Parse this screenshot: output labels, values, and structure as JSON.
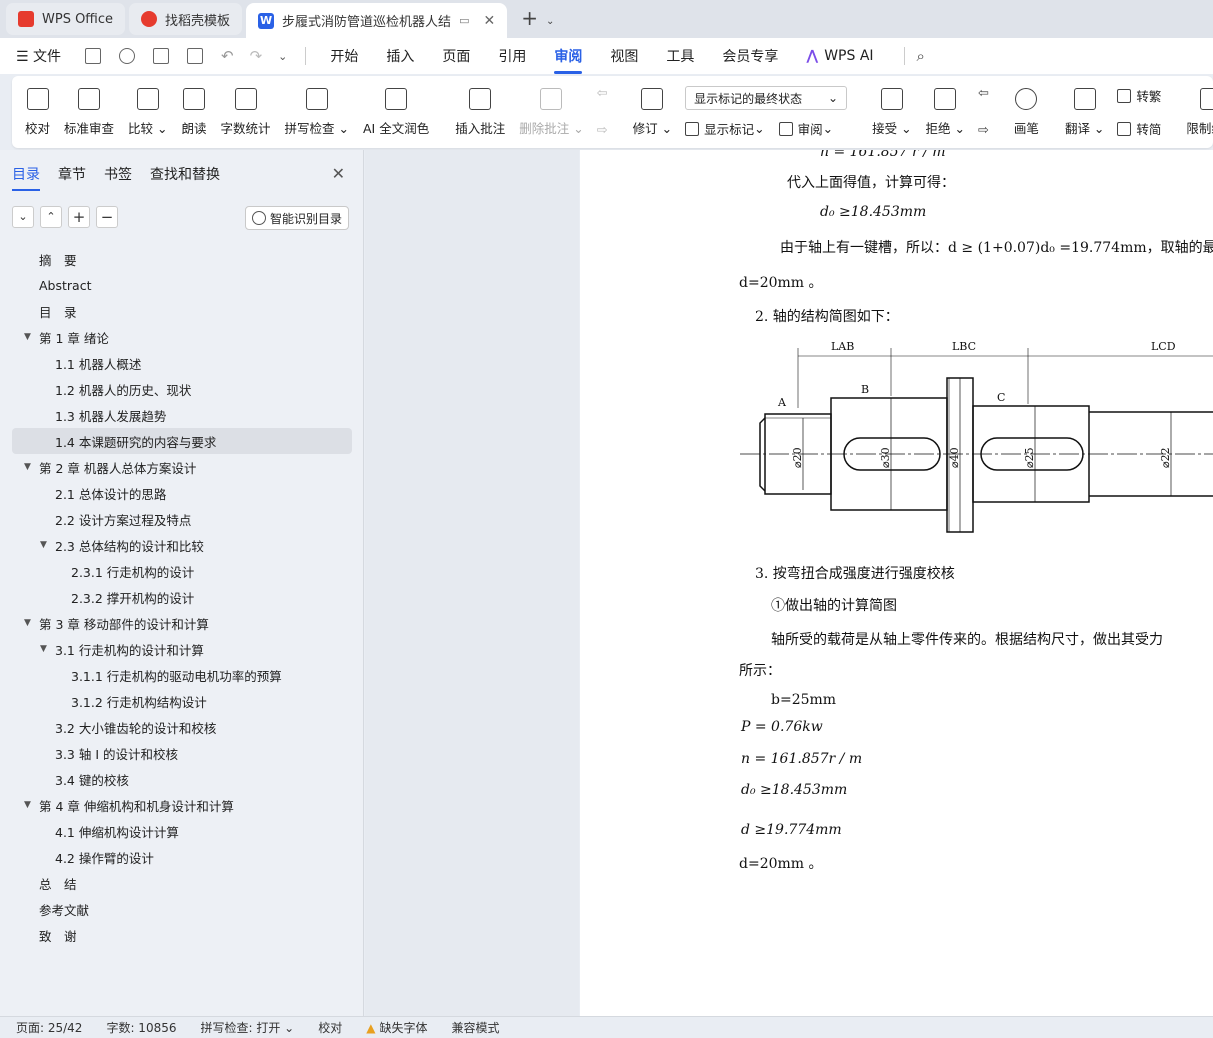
{
  "tabs": [
    {
      "label": "WPS Office"
    },
    {
      "label": "找稻壳模板"
    },
    {
      "label": "步履式消防管道巡检机器人结"
    }
  ],
  "menu": {
    "file": "文件",
    "items": [
      "开始",
      "插入",
      "页面",
      "引用",
      "审阅",
      "视图",
      "工具",
      "会员专享"
    ],
    "active": "审阅",
    "ai": "WPS AI"
  },
  "ribbon": {
    "proofread": "校对",
    "standard_review": "标准审查",
    "compare": "比较",
    "read_aloud": "朗读",
    "word_count": "字数统计",
    "spell_check": "拼写检查",
    "ai_polish": "AI 全文润色",
    "insert_comment": "插入批注",
    "delete_comment": "删除批注",
    "track": "修订",
    "markup_dropdown": "显示标记的最终状态",
    "show_markup": "显示标记",
    "review_pane": "审阅",
    "accept": "接受",
    "reject": "拒绝",
    "pen": "画笔",
    "translate": "翻译",
    "to_traditional": "转繁",
    "to_simplified": "转简",
    "restrict_edit": "限制编辑"
  },
  "nav": {
    "tabs": [
      "目录",
      "章节",
      "书签",
      "查找和替换"
    ],
    "active_tab": "目录",
    "smart_button": "智能识别目录",
    "toc": [
      {
        "label": "摘　要",
        "level": 0,
        "arrow": ""
      },
      {
        "label": "Abstract",
        "level": 0,
        "arrow": ""
      },
      {
        "label": "目　录",
        "level": 0,
        "arrow": ""
      },
      {
        "label": "第 1 章 绪论",
        "level": 0,
        "arrow": "▼"
      },
      {
        "label": "1.1 机器人概述",
        "level": 1,
        "arrow": ""
      },
      {
        "label": "1.2 机器人的历史、现状",
        "level": 1,
        "arrow": ""
      },
      {
        "label": "1.3 机器人发展趋势",
        "level": 1,
        "arrow": ""
      },
      {
        "label": "1.4 本课题研究的内容与要求",
        "level": 1,
        "arrow": "",
        "selected": true
      },
      {
        "label": "第 2 章 机器人总体方案设计",
        "level": 0,
        "arrow": "▼"
      },
      {
        "label": "2.1 总体设计的思路",
        "level": 1,
        "arrow": ""
      },
      {
        "label": "2.2 设计方案过程及特点",
        "level": 1,
        "arrow": ""
      },
      {
        "label": "2.3 总体结构的设计和比较",
        "level": 1,
        "arrow": "▼"
      },
      {
        "label": "2.3.1 行走机构的设计",
        "level": 2,
        "arrow": ""
      },
      {
        "label": "2.3.2 撑开机构的设计",
        "level": 2,
        "arrow": ""
      },
      {
        "label": "第 3 章 移动部件的设计和计算",
        "level": 0,
        "arrow": "▼"
      },
      {
        "label": "3.1 行走机构的设计和计算",
        "level": 1,
        "arrow": "▼"
      },
      {
        "label": "3.1.1 行走机构的驱动电机功率的预算",
        "level": 2,
        "arrow": ""
      },
      {
        "label": "3.1.2 行走机构结构设计",
        "level": 2,
        "arrow": ""
      },
      {
        "label": "3.2 大小锥齿轮的设计和校核",
        "level": 1,
        "arrow": ""
      },
      {
        "label": "3.3 轴 I 的设计和校核",
        "level": 1,
        "arrow": ""
      },
      {
        "label": "3.4 键的校核",
        "level": 1,
        "arrow": ""
      },
      {
        "label": "第 4 章 伸缩机构和机身设计和计算",
        "level": 0,
        "arrow": "▼"
      },
      {
        "label": "4.1 伸缩机构设计计算",
        "level": 1,
        "arrow": ""
      },
      {
        "label": "4.2 操作臂的设计",
        "level": 1,
        "arrow": ""
      },
      {
        "label": "总　结",
        "level": 0,
        "arrow": ""
      },
      {
        "label": "参考文献",
        "level": 0,
        "arrow": ""
      },
      {
        "label": "致　谢",
        "level": 0,
        "arrow": ""
      }
    ]
  },
  "doc": {
    "l0": "n = 161.857 r / m",
    "l1": "代入上面得值，计算可得：",
    "l2": "d₀ ≥18.453mm",
    "l3": "由于轴上有一键槽，所以：d ≥ (1+0.07)d₀ =19.774mm，取轴的最",
    "l4": "d=20mm 。",
    "l5": "2.  轴的结构简图如下：",
    "l6": "3.  按弯扭合成强度进行强度校核",
    "l7": "①做出轴的计算简图",
    "l8": "轴所受的载荷是从轴上零件传来的。根据结构尺寸，做出其受力",
    "l9": "所示：",
    "l10": "b=25mm",
    "l11": "P = 0.76kw",
    "l12": "n = 161.857r / m",
    "l13": "d₀ ≥18.453mm",
    "l14": "d ≥19.774mm",
    "l15": "d=20mm 。",
    "drawing": {
      "labels": {
        "lab": "LAB",
        "lbc": "LBC",
        "lcd": "LCD",
        "a": "A",
        "b": "B",
        "c": "C",
        "d20": "⌀20",
        "d30": "⌀30",
        "d40": "⌀40",
        "d25": "⌀25",
        "d22": "⌀22"
      }
    }
  },
  "status": {
    "page": "页面: 25/42",
    "words": "字数: 10856",
    "spell": "拼写检查: 打开",
    "proof": "校对",
    "missing_font": "缺失字体",
    "compat": "兼容模式"
  }
}
